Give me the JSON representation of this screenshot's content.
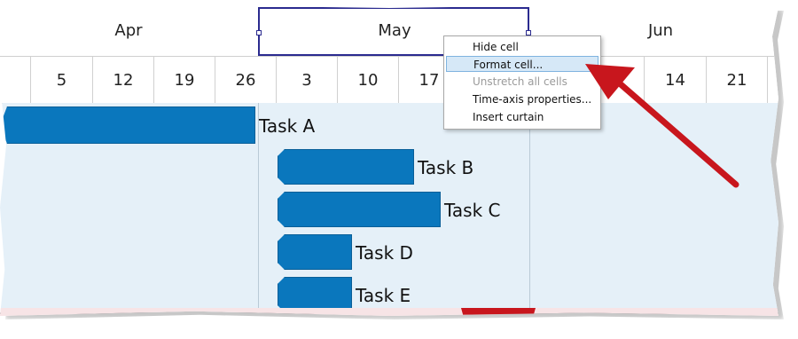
{
  "timeline": {
    "months": [
      "Apr",
      "May",
      "Jun"
    ],
    "weeks": [
      "5",
      "12",
      "19",
      "26",
      "3",
      "10",
      "17",
      "",
      "",
      "14",
      "21"
    ]
  },
  "tasks": [
    {
      "label": "Task A"
    },
    {
      "label": "Task B"
    },
    {
      "label": "Task C"
    },
    {
      "label": "Task D"
    },
    {
      "label": "Task E"
    }
  ],
  "context_menu": {
    "items": [
      {
        "label": "Hide cell",
        "state": "normal"
      },
      {
        "label": "Format cell...",
        "state": "selected"
      },
      {
        "label": "Unstretch all cells",
        "state": "disabled"
      },
      {
        "label": "Time-axis properties...",
        "state": "normal"
      },
      {
        "label": "Insert curtain",
        "state": "normal"
      }
    ]
  },
  "colors": {
    "task_bar": "#0a77bd",
    "body_background": "#e5f0f8",
    "selection_border": "#2b2b8f",
    "annotation_arrow": "#c8161d",
    "menu_highlight": "#d6e8f7"
  },
  "icons": {
    "annotation": "red-arrow-icon"
  }
}
